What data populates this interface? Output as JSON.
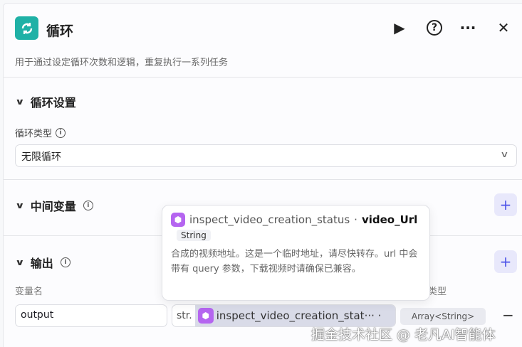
{
  "header": {
    "title": "循环",
    "description": "用于通过设定循环次数和逻辑，重复执行一系列任务"
  },
  "loop_settings": {
    "title": "循环设置",
    "type_label": "循环类型",
    "type_value": "无限循环"
  },
  "intermediate": {
    "title": "中间变量"
  },
  "output": {
    "title": "输出",
    "col_name": "变量名",
    "col_type": "变量类型",
    "row": {
      "name": "output",
      "prefix": "str.",
      "ref": "inspect_video_creation_stat··· ·",
      "type": "Array<String>"
    }
  },
  "tooltip": {
    "node": "inspect_video_creation_status",
    "sep": "·",
    "field": "video_Url",
    "type": "String",
    "description": "合成的视频地址。这是一个临时地址，请尽快转存。url 中会带有 query 参数，下载视频时请确保已兼容。"
  },
  "watermark": "掘金技术社区 @ 老凡AI智能体",
  "colors": {
    "accent": "#4d53e8",
    "logo": "#1fb1a6",
    "cube": "#b565f0"
  }
}
